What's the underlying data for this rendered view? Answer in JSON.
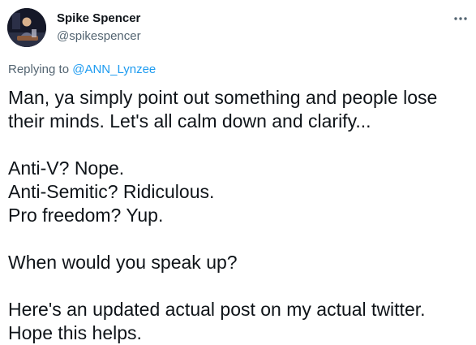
{
  "tweet": {
    "author": {
      "display_name": "Spike Spencer",
      "handle": "@spikespencer"
    },
    "reply": {
      "prefix": "Replying to",
      "mention": "@ANN_Lynzee"
    },
    "more_icon": "more-horizontal-icon",
    "body": {
      "p1_l1": "Man, ya simply point out something and people lose",
      "p1_l2": "their minds. Let's all calm down and clarify...",
      "p2_l1": "Anti-V? Nope.",
      "p2_l2": "Anti-Semitic? Ridiculous.",
      "p2_l3": "Pro freedom? Yup.",
      "p3_l1": "When would you speak up?",
      "p4_l1": "Here's an updated actual post on my actual twitter.",
      "p4_l2": "Hope this helps."
    }
  },
  "colors": {
    "text": "#0f1419",
    "secondary": "#536471",
    "link": "#1d9bf0"
  }
}
